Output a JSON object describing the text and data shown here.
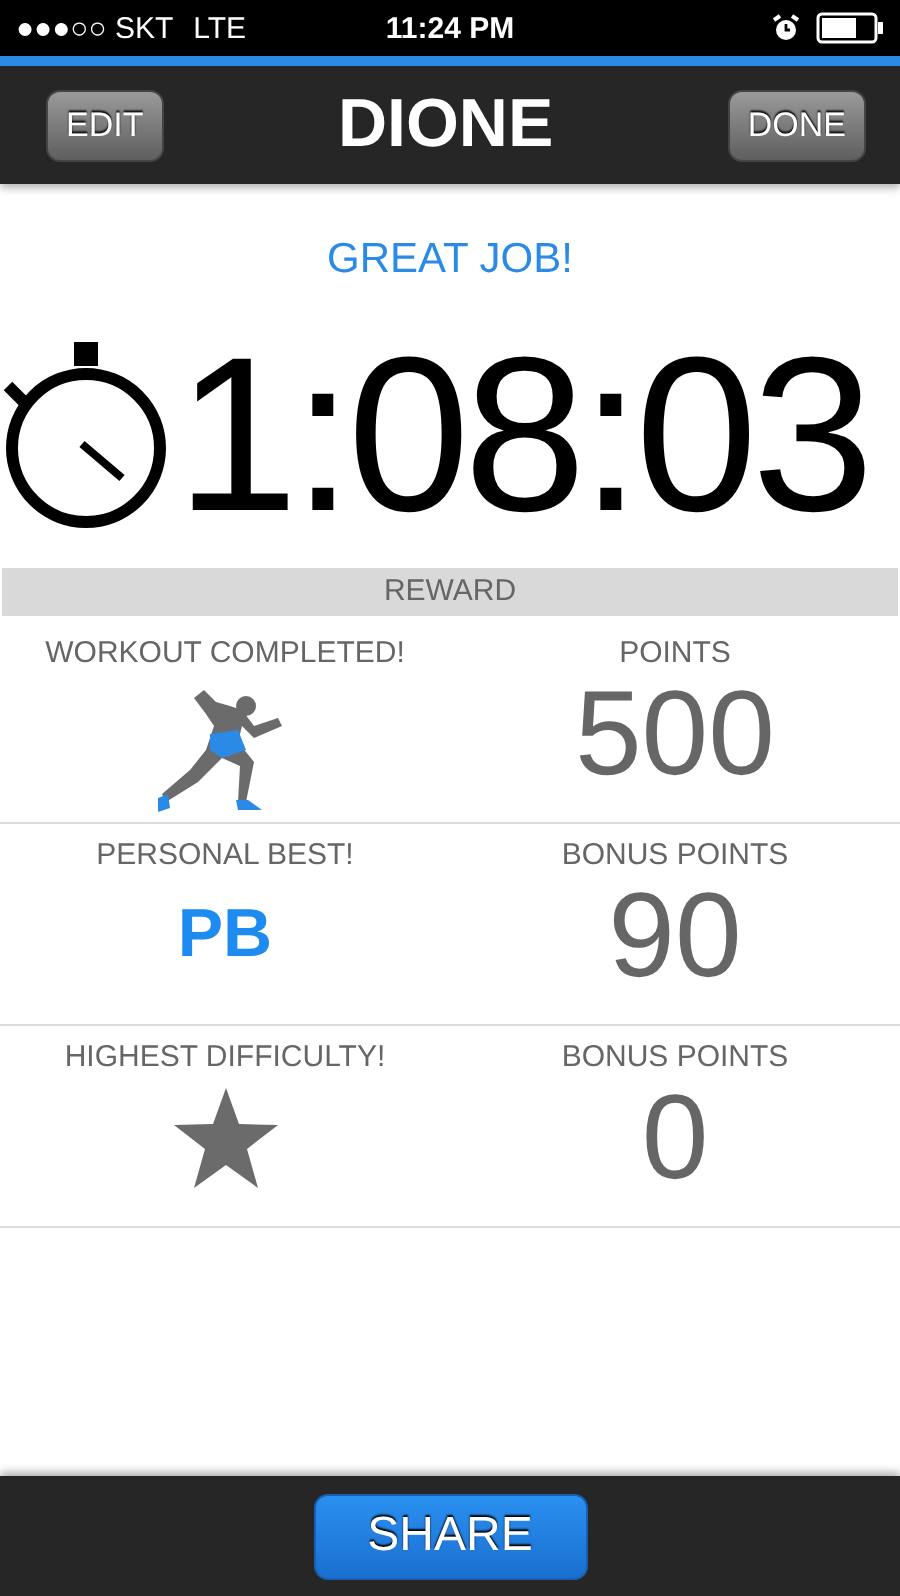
{
  "status_bar": {
    "carrier": "●●●○○ SKT",
    "network": "LTE",
    "time": "11:24 PM"
  },
  "nav_bar": {
    "left_button": "EDIT",
    "title": "DIONE",
    "right_button": "DONE"
  },
  "message": "GREAT JOB!",
  "timer": "1:08:03",
  "reward_header": "REWARD",
  "rewards": [
    {
      "kind": "runner",
      "label": "WORKOUT COMPLETED!",
      "points_label": "POINTS",
      "points": "500"
    },
    {
      "kind": "badge",
      "label": "PERSONAL BEST!",
      "badge": "PB",
      "points_label": "BONUS POINTS",
      "points": "90"
    },
    {
      "kind": "star",
      "label": "HIGHEST DIFFICULTY!",
      "points_label": "BONUS POINTS",
      "points": "0"
    }
  ],
  "share_button": "SHARE"
}
